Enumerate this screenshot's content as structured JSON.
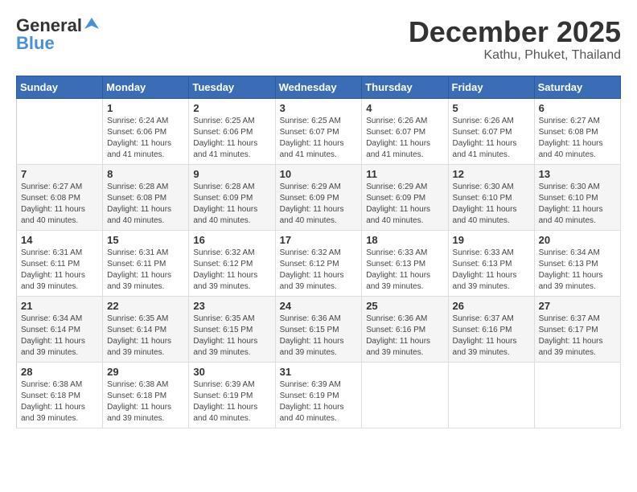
{
  "header": {
    "logo_general": "General",
    "logo_blue": "Blue",
    "month": "December 2025",
    "location": "Kathu, Phuket, Thailand"
  },
  "weekdays": [
    "Sunday",
    "Monday",
    "Tuesday",
    "Wednesday",
    "Thursday",
    "Friday",
    "Saturday"
  ],
  "weeks": [
    [
      {
        "day": "",
        "info": ""
      },
      {
        "day": "1",
        "info": "Sunrise: 6:24 AM\nSunset: 6:06 PM\nDaylight: 11 hours and 41 minutes."
      },
      {
        "day": "2",
        "info": "Sunrise: 6:25 AM\nSunset: 6:06 PM\nDaylight: 11 hours and 41 minutes."
      },
      {
        "day": "3",
        "info": "Sunrise: 6:25 AM\nSunset: 6:07 PM\nDaylight: 11 hours and 41 minutes."
      },
      {
        "day": "4",
        "info": "Sunrise: 6:26 AM\nSunset: 6:07 PM\nDaylight: 11 hours and 41 minutes."
      },
      {
        "day": "5",
        "info": "Sunrise: 6:26 AM\nSunset: 6:07 PM\nDaylight: 11 hours and 41 minutes."
      },
      {
        "day": "6",
        "info": "Sunrise: 6:27 AM\nSunset: 6:08 PM\nDaylight: 11 hours and 40 minutes."
      }
    ],
    [
      {
        "day": "7",
        "info": "Sunrise: 6:27 AM\nSunset: 6:08 PM\nDaylight: 11 hours and 40 minutes."
      },
      {
        "day": "8",
        "info": "Sunrise: 6:28 AM\nSunset: 6:08 PM\nDaylight: 11 hours and 40 minutes."
      },
      {
        "day": "9",
        "info": "Sunrise: 6:28 AM\nSunset: 6:09 PM\nDaylight: 11 hours and 40 minutes."
      },
      {
        "day": "10",
        "info": "Sunrise: 6:29 AM\nSunset: 6:09 PM\nDaylight: 11 hours and 40 minutes."
      },
      {
        "day": "11",
        "info": "Sunrise: 6:29 AM\nSunset: 6:09 PM\nDaylight: 11 hours and 40 minutes."
      },
      {
        "day": "12",
        "info": "Sunrise: 6:30 AM\nSunset: 6:10 PM\nDaylight: 11 hours and 40 minutes."
      },
      {
        "day": "13",
        "info": "Sunrise: 6:30 AM\nSunset: 6:10 PM\nDaylight: 11 hours and 40 minutes."
      }
    ],
    [
      {
        "day": "14",
        "info": "Sunrise: 6:31 AM\nSunset: 6:11 PM\nDaylight: 11 hours and 39 minutes."
      },
      {
        "day": "15",
        "info": "Sunrise: 6:31 AM\nSunset: 6:11 PM\nDaylight: 11 hours and 39 minutes."
      },
      {
        "day": "16",
        "info": "Sunrise: 6:32 AM\nSunset: 6:12 PM\nDaylight: 11 hours and 39 minutes."
      },
      {
        "day": "17",
        "info": "Sunrise: 6:32 AM\nSunset: 6:12 PM\nDaylight: 11 hours and 39 minutes."
      },
      {
        "day": "18",
        "info": "Sunrise: 6:33 AM\nSunset: 6:13 PM\nDaylight: 11 hours and 39 minutes."
      },
      {
        "day": "19",
        "info": "Sunrise: 6:33 AM\nSunset: 6:13 PM\nDaylight: 11 hours and 39 minutes."
      },
      {
        "day": "20",
        "info": "Sunrise: 6:34 AM\nSunset: 6:13 PM\nDaylight: 11 hours and 39 minutes."
      }
    ],
    [
      {
        "day": "21",
        "info": "Sunrise: 6:34 AM\nSunset: 6:14 PM\nDaylight: 11 hours and 39 minutes."
      },
      {
        "day": "22",
        "info": "Sunrise: 6:35 AM\nSunset: 6:14 PM\nDaylight: 11 hours and 39 minutes."
      },
      {
        "day": "23",
        "info": "Sunrise: 6:35 AM\nSunset: 6:15 PM\nDaylight: 11 hours and 39 minutes."
      },
      {
        "day": "24",
        "info": "Sunrise: 6:36 AM\nSunset: 6:15 PM\nDaylight: 11 hours and 39 minutes."
      },
      {
        "day": "25",
        "info": "Sunrise: 6:36 AM\nSunset: 6:16 PM\nDaylight: 11 hours and 39 minutes."
      },
      {
        "day": "26",
        "info": "Sunrise: 6:37 AM\nSunset: 6:16 PM\nDaylight: 11 hours and 39 minutes."
      },
      {
        "day": "27",
        "info": "Sunrise: 6:37 AM\nSunset: 6:17 PM\nDaylight: 11 hours and 39 minutes."
      }
    ],
    [
      {
        "day": "28",
        "info": "Sunrise: 6:38 AM\nSunset: 6:18 PM\nDaylight: 11 hours and 39 minutes."
      },
      {
        "day": "29",
        "info": "Sunrise: 6:38 AM\nSunset: 6:18 PM\nDaylight: 11 hours and 39 minutes."
      },
      {
        "day": "30",
        "info": "Sunrise: 6:39 AM\nSunset: 6:19 PM\nDaylight: 11 hours and 40 minutes."
      },
      {
        "day": "31",
        "info": "Sunrise: 6:39 AM\nSunset: 6:19 PM\nDaylight: 11 hours and 40 minutes."
      },
      {
        "day": "",
        "info": ""
      },
      {
        "day": "",
        "info": ""
      },
      {
        "day": "",
        "info": ""
      }
    ]
  ]
}
